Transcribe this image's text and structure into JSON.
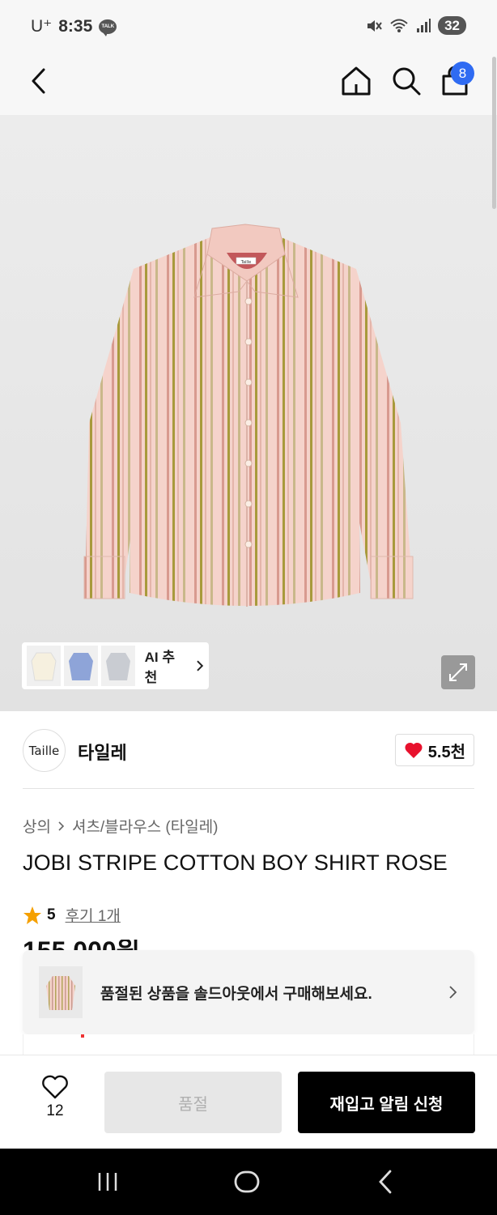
{
  "status_bar": {
    "carrier": "U⁺",
    "time": "8:35",
    "notification_icon": "talk-icon",
    "talk_label": "TALK",
    "battery": "32"
  },
  "nav": {
    "cart_count": "8"
  },
  "hero": {
    "ai_recommend_label": "AI 추천",
    "shirt_tag": "Taille"
  },
  "brand": {
    "logo_text": "Taille",
    "name": "타일레",
    "likes": "5.5천"
  },
  "breadcrumb": [
    "상의",
    "셔츠/블라우스 (타일레)"
  ],
  "product": {
    "title": "JOBI STRIPE COTTON BOY SHIRT ROSE",
    "rating": "5",
    "review_link": "후기 1개",
    "price_peek": "155,000원"
  },
  "soldout_banner": {
    "text": "품절된 상품을 솔드아웃에서 구매해보세요."
  },
  "bottom_bar": {
    "wish_count": "12",
    "soldout_label": "품절",
    "restock_label": "재입고 알림 신청"
  },
  "colors": {
    "accent_blue": "#2f6bf2",
    "heart_red": "#e8112d",
    "star_orange": "#f5a000",
    "shirt_pink": "#f3cdc6",
    "stripe_olive": "#a89a3c"
  }
}
